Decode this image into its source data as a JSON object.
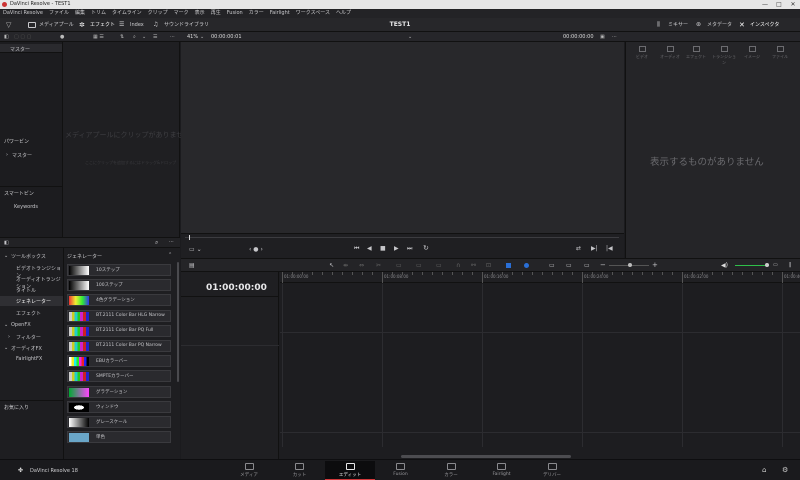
{
  "window": {
    "title": "DaVinci Resolve - TEST1",
    "controls": [
      "—",
      "□",
      "✕"
    ]
  },
  "menu": [
    "DaVinci Resolve",
    "ファイル",
    "編集",
    "トリム",
    "タイムライン",
    "クリップ",
    "マーク",
    "表示",
    "再生",
    "Fusion",
    "カラー",
    "Fairlight",
    "ワークスペース",
    "ヘルプ"
  ],
  "toolbar": {
    "media_pool": "メディアプール",
    "effects": "エフェクト",
    "index": "Index",
    "sound_library": "サウンドライブラリ",
    "project_title": "TEST1",
    "mixer": "ミキサー",
    "metadata": "メタデータ",
    "inspector": "インスペクタ"
  },
  "subbar": {
    "zoom": "41%",
    "src_timecode": "00:00:00:01",
    "rec_timecode": "00:00:00:00"
  },
  "bins": {
    "master": "マスター",
    "power_bins": "パワービン",
    "power_bin_master": "マスター",
    "smart_bins": "スマートビン",
    "smart_keywords": "Keywords"
  },
  "media_pool": {
    "empty_text": "メディアプールにクリップがありません",
    "hint_text": "ここにクリップを追加するにはドラッグ&ドロップ"
  },
  "inspector": {
    "tabs": [
      "ビデオ",
      "オーディオ",
      "エフェクト",
      "トランジション",
      "イメージ",
      "ファイル"
    ],
    "empty_text": "表示するものがありません"
  },
  "effects_tree": {
    "toolbox": "ツールボックス",
    "items": [
      "ビデオトランジション",
      "オーディオトランジション",
      "タイトル",
      "ジェネレーター",
      "エフェクト"
    ],
    "openfx": "OpenFX",
    "filter": "フィルター",
    "audiofx": "オーディオFX",
    "fairlightfx": "FairlightFX",
    "favorites": "お気に入り",
    "selected": "ジェネレーター"
  },
  "generators": {
    "header": "ジェネレーター",
    "items": [
      {
        "name": "10ステップ",
        "thumb": "gradient-gray"
      },
      {
        "name": "100ステップ",
        "thumb": "gradient-gray"
      },
      {
        "name": "4色グラデーション",
        "thumb": "four-color"
      },
      {
        "name": "BT.2111 Color Bar HLG Narrow",
        "thumb": "bars"
      },
      {
        "name": "BT.2111 Color Bar PQ Full",
        "thumb": "bars"
      },
      {
        "name": "BT.2111 Color Bar PQ Narrow",
        "thumb": "bars"
      },
      {
        "name": "EBUカラーバー",
        "thumb": "ebu"
      },
      {
        "name": "SMPTEカラーバー",
        "thumb": "smpte"
      },
      {
        "name": "グラデーション",
        "thumb": "grad-green"
      },
      {
        "name": "ウィンドウ",
        "thumb": "window"
      },
      {
        "name": "グレースケール",
        "thumb": "grayscale"
      },
      {
        "name": "単色",
        "thumb": "solid"
      }
    ]
  },
  "timeline": {
    "timecode": "01:00:00:00",
    "ruler": [
      "01:00:00:00",
      "01:00:08:00",
      "01:00:16:00",
      "01:00:24:00",
      "01:00:32:00",
      "01:00:40:00"
    ]
  },
  "pages": [
    {
      "name": "メディア",
      "active": false
    },
    {
      "name": "カット",
      "active": false
    },
    {
      "name": "エディット",
      "active": true
    },
    {
      "name": "Fusion",
      "active": false
    },
    {
      "name": "カラー",
      "active": false
    },
    {
      "name": "Fairlight",
      "active": false
    },
    {
      "name": "デリバー",
      "active": false
    }
  ],
  "app_name": "DaVinci Resolve 18",
  "colors": {
    "accent_red": "#d0383a",
    "volume_green": "#2fbf4a",
    "blue_flag": "#2a6fd6"
  }
}
